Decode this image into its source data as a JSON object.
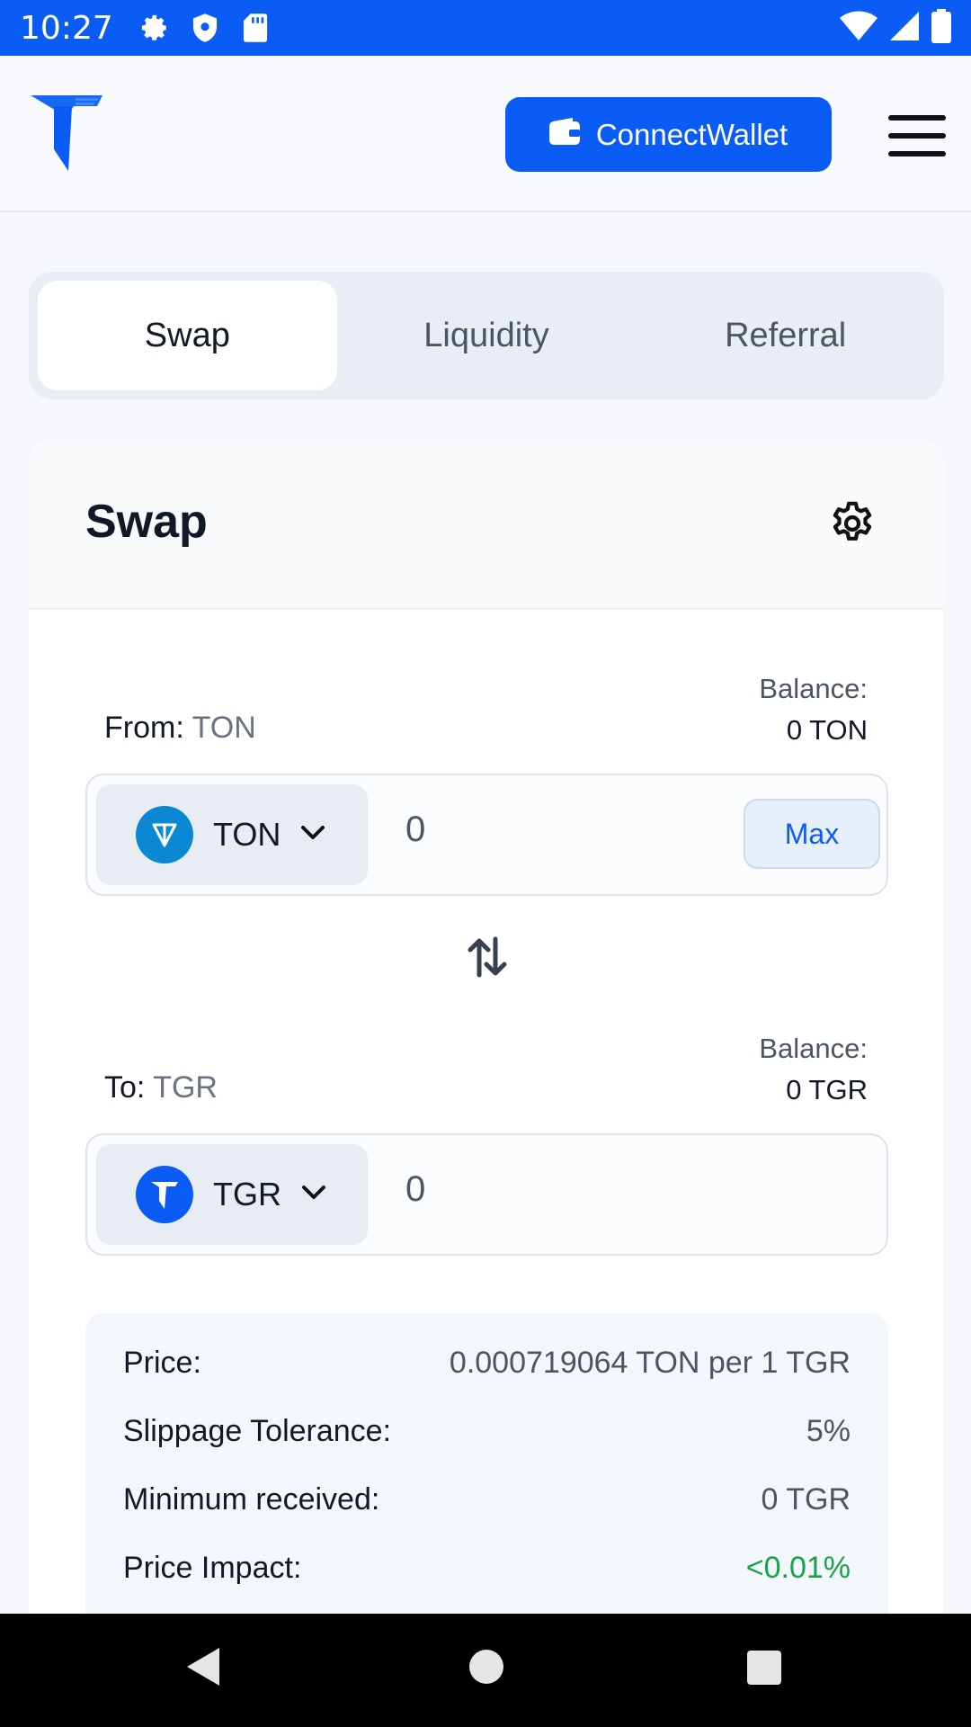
{
  "status_bar": {
    "time": "10:27",
    "icons": [
      "settings-icon",
      "shield-icon",
      "sd-card-icon",
      "wifi-icon",
      "signal-icon",
      "battery-icon"
    ]
  },
  "header": {
    "connect_label": "ConnectWallet",
    "accent_color": "#0b5cf5"
  },
  "tabs": [
    {
      "label": "Swap",
      "active": true
    },
    {
      "label": "Liquidity",
      "active": false
    },
    {
      "label": "Referral",
      "active": false
    }
  ],
  "card": {
    "title": "Swap",
    "from": {
      "label": "From:",
      "token": "TON",
      "balance_label": "Balance:",
      "balance_value": "0 TON",
      "amount": "0",
      "max_label": "Max"
    },
    "to": {
      "label": "To:",
      "token": "TGR",
      "balance_label": "Balance:",
      "balance_value": "0 TGR",
      "amount": "0"
    },
    "info": {
      "price_label": "Price:",
      "price_value": "0.000719064 TON per 1 TGR",
      "slippage_label": "Slippage Tolerance:",
      "slippage_value": "5%",
      "min_received_label": "Minimum received:",
      "min_received_value": "0 TGR",
      "impact_label": "Price Impact:",
      "impact_value": "<0.01%",
      "impact_color": "#16a34a"
    }
  }
}
